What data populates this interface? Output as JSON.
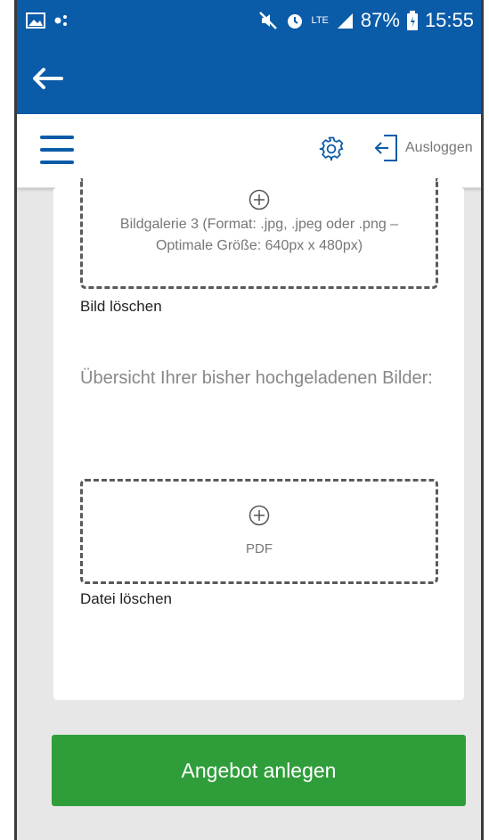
{
  "status_bar": {
    "battery": "87%",
    "time": "15:55",
    "network": "LTE",
    "icons": [
      "image-icon",
      "notification-dots-icon",
      "mute-icon",
      "alarm-icon",
      "signal-icon",
      "battery-icon"
    ]
  },
  "appbar": {
    "back_icon": "arrow-left-icon"
  },
  "toolbar": {
    "menu_icon": "hamburger-menu-icon",
    "settings_icon": "gear-icon",
    "logout_icon": "logout-icon",
    "logout_label": "Ausloggen"
  },
  "gallery_upload": {
    "icon": "plus-circle-icon",
    "line1": "Bildgalerie 3 (Format: .jpg, .jpeg oder .png –",
    "line2": "Optimale Größe: 640px x 480px)",
    "delete_link": "Bild löschen"
  },
  "overview_text": "Übersicht Ihrer bisher hochgeladenen Bilder:",
  "pdf_upload": {
    "icon": "plus-circle-icon",
    "label": "PDF",
    "delete_link": "Datei löschen"
  },
  "cta_label": "Angebot anlegen",
  "colors": {
    "primary": "#0a5ba8",
    "cta": "#2f9e3a",
    "background": "#e7e7e7"
  }
}
